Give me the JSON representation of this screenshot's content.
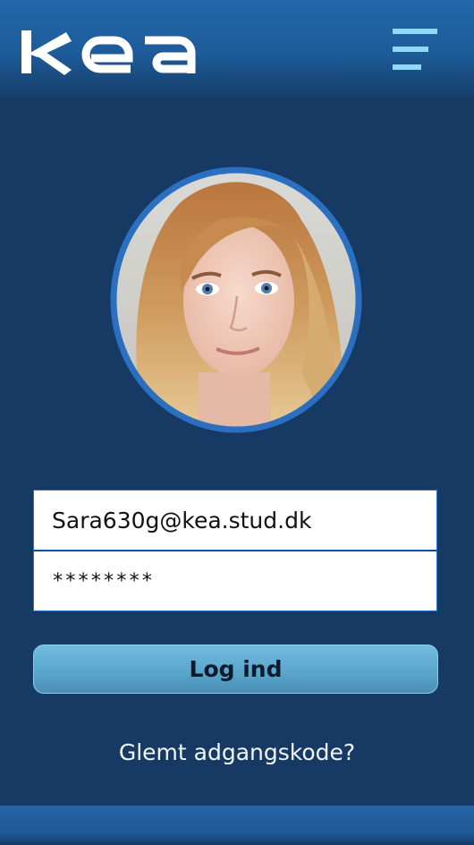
{
  "header": {
    "logo_text": "kea",
    "logo_icon": "kea-logo",
    "menu_icon": "hamburger-menu-icon"
  },
  "profile": {
    "avatar_icon": "user-photo"
  },
  "login": {
    "email_value": "Sara630g@kea.stud.dk",
    "password_value": "********",
    "submit_label": "Log ind",
    "forgot_label": "Glemt adgangskode?"
  },
  "colors": {
    "background": "#163a63",
    "header": "#1d5b99",
    "accent": "#8fd8f8",
    "button": "#5aa6cd",
    "avatar_ring": "#2a6fc0"
  }
}
